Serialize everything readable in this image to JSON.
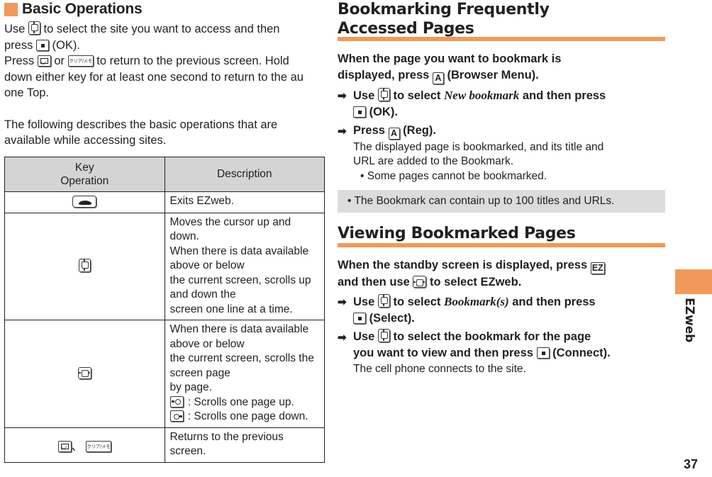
{
  "colors": {
    "accent": "#f0995a",
    "header_gray": "#d4d4d4",
    "note_gray": "#dcdcdc",
    "text": "#231f20"
  },
  "left": {
    "heading": "Basic Operations",
    "intro_line1_a": "Use",
    "intro_line1_b": "to select the site you want to access and then",
    "intro_line2_a": "press",
    "intro_line2_b": "(OK).",
    "intro_line3_a": "Press",
    "intro_line3_or": "or",
    "intro_line3_b": "to return to the previous screen. Hold",
    "intro_line4": "down either key for at least one second to return to the au",
    "intro_line5": "one Top.",
    "second_para_line1": "The following describes the basic operations that are",
    "second_para_line2": "available while accessing sites.",
    "table": {
      "headers": [
        "Key Operation",
        "Description"
      ],
      "header_key_line1": "Key",
      "header_key_line2": "Operation",
      "rows": [
        {
          "key_icon": "end-call-key",
          "description": "Exits EZweb."
        },
        {
          "key_icon": "up-down-key",
          "description_lines": [
            "Moves the cursor up and down.",
            "When there is data available above or below",
            "the current screen, scrolls up and down the",
            "screen one line at a time."
          ]
        },
        {
          "key_icon": "left-right-key",
          "description_lines": [
            "When there is data available above or below",
            "the current screen, scrolls the screen page",
            "by page."
          ],
          "sub_items": [
            {
              "icon": "page-up-key",
              "text": ": Scrolls one page up."
            },
            {
              "icon": "page-down-key",
              "text": ": Scrolls one page down."
            }
          ]
        },
        {
          "key_icon": "mail-key",
          "key_separator": "、",
          "key_icon2": "clear-memo-key",
          "key_icon2_label": "クリア/メモ",
          "description": "Returns to the previous screen."
        }
      ]
    }
  },
  "right": {
    "section1": {
      "heading_line1": "Bookmarking Frequently",
      "heading_line2": "Accessed Pages",
      "lead_line1": "When the page you want to bookmark is",
      "lead_line2_a": "displayed, press",
      "lead_line2_key": "A",
      "lead_line2_b": "(Browser Menu).",
      "steps": [
        {
          "line1_a": "Use",
          "line1_b": "to select",
          "line1_italic": "New bookmark",
          "line1_c": "and then press",
          "line2": "(OK)."
        },
        {
          "line1_a": "Press",
          "line1_key": "A",
          "line1_b": "(Reg).",
          "notes": [
            "The displayed page is bookmarked, and its title and",
            "URL are added to the Bookmark."
          ],
          "bullets": [
            "• Some pages cannot be bookmarked."
          ]
        }
      ],
      "graybox": "• The Bookmark can contain up to 100 titles and URLs."
    },
    "section2": {
      "heading": "Viewing Bookmarked Pages",
      "lead_line1_a": "When the standby screen is displayed, press",
      "lead_line1_key": "EZ",
      "lead_line2_a": "and then use",
      "lead_line2_b": "to select",
      "lead_line2_italic": "EZweb",
      "lead_line2_c": ".",
      "steps": [
        {
          "line1_a": "Use",
          "line1_b": "to select",
          "line1_italic": "Bookmark(s)",
          "line1_c": "and then press",
          "line2": "(Select)."
        },
        {
          "line1_a": "Use",
          "line1_b": "to select the bookmark for the page",
          "line2_a": "you want to view and then press",
          "line2_b": "(Connect).",
          "notes": [
            "The cell phone connects to the site."
          ]
        }
      ]
    }
  },
  "edge": {
    "tab_label": "EZweb",
    "page_number": "37"
  },
  "arrow_glyph": "➡"
}
